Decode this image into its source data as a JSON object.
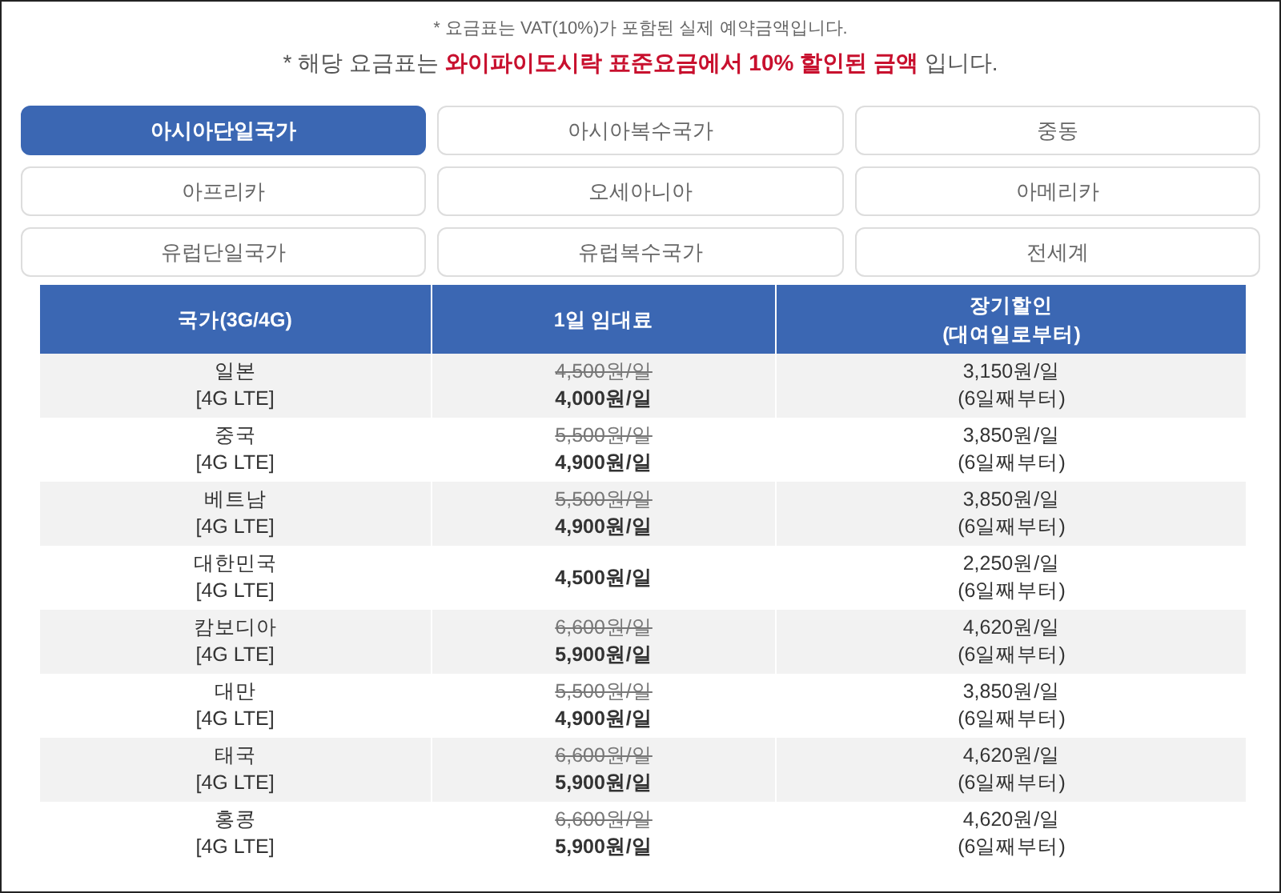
{
  "notes": [
    {
      "kind": "small",
      "text": "* 요금표는 VAT(10%)가 포함된 실제 예약금액입니다."
    },
    {
      "kind": "large",
      "text": "* 해당 요금표는 **와이파이도시락 표준요금에서 10% 할인된 금액** 입니다."
    }
  ],
  "region_tabs": [
    {
      "label": "아시아단일국가",
      "selected": true
    },
    {
      "label": "아시아복수국가",
      "selected": false
    },
    {
      "label": "중동",
      "selected": false
    },
    {
      "label": "아프리카",
      "selected": false
    },
    {
      "label": "오세아니아",
      "selected": false
    },
    {
      "label": "아메리카",
      "selected": false
    },
    {
      "label": "유럽단일국가",
      "selected": false
    },
    {
      "label": "유럽복수국가",
      "selected": false
    },
    {
      "label": "전세계",
      "selected": false
    }
  ],
  "table": {
    "columns": [
      {
        "lines": [
          "국가(3G/4G)"
        ]
      },
      {
        "lines": [
          "1일 임대료"
        ]
      },
      {
        "lines": [
          "장기할인",
          "(대여일로부터)"
        ]
      }
    ],
    "rows": [
      {
        "country": "일본",
        "network": "[4G LTE]",
        "original_price": "4,500원/일",
        "price": "4,000원/일",
        "long_term_price": "3,150원/일",
        "long_term_note": "(6일째부터)"
      },
      {
        "country": "중국",
        "network": "[4G LTE]",
        "original_price": "5,500원/일",
        "price": "4,900원/일",
        "long_term_price": "3,850원/일",
        "long_term_note": "(6일째부터)"
      },
      {
        "country": "베트남",
        "network": "[4G LTE]",
        "original_price": "5,500원/일",
        "price": "4,900원/일",
        "long_term_price": "3,850원/일",
        "long_term_note": "(6일째부터)"
      },
      {
        "country": "대한민국",
        "network": "[4G LTE]",
        "price": "4,500원/일",
        "long_term_price": "2,250원/일",
        "long_term_note": "(6일째부터)"
      },
      {
        "country": "캄보디아",
        "network": "[4G LTE]",
        "original_price": "6,600원/일",
        "price": "5,900원/일",
        "long_term_price": "4,620원/일",
        "long_term_note": "(6일째부터)"
      },
      {
        "country": "대만",
        "network": "[4G LTE]",
        "original_price": "5,500원/일",
        "price": "4,900원/일",
        "long_term_price": "3,850원/일",
        "long_term_note": "(6일째부터)"
      },
      {
        "country": "태국",
        "network": "[4G LTE]",
        "original_price": "6,600원/일",
        "price": "5,900원/일",
        "long_term_price": "4,620원/일",
        "long_term_note": "(6일째부터)"
      },
      {
        "country": "홍콩",
        "network": "[4G LTE]",
        "original_price": "6,600원/일",
        "price": "5,900원/일",
        "long_term_price": "4,620원/일",
        "long_term_note": "(6일째부터)"
      }
    ]
  }
}
